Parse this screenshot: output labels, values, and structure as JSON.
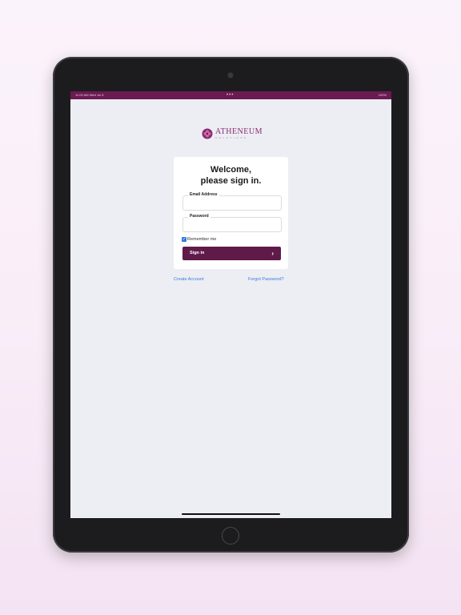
{
  "status_bar": {
    "left": "11:09 AM  Wed Jul 6",
    "dots": "•••",
    "right": "100%"
  },
  "logo": {
    "title": "ATHENEUM",
    "subtitle": "SOLUTIONS"
  },
  "form": {
    "welcome_line1": "Welcome,",
    "welcome_line2": "please sign in.",
    "email_label": "Email Address",
    "email_value": "",
    "password_label": "Password",
    "password_value": "",
    "remember_label": "Remember me",
    "remember_checked": true,
    "signin_label": "Sign in"
  },
  "links": {
    "create_account": "Create Account",
    "forgot_password": "Forgot Password?"
  },
  "colors": {
    "brand": "#5f1a4a",
    "status_bar": "#6b1a52",
    "link": "#3c7bd8",
    "checkbox": "#2d7de0"
  }
}
